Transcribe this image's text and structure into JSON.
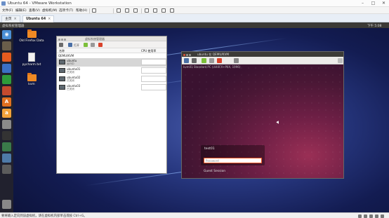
{
  "window": {
    "title": "Ubuntu 64 - VMware Workstation"
  },
  "menu": {
    "items": [
      "文件(F)",
      "编辑(E)",
      "查看(V)",
      "虚拟机(M)",
      "选项卡(T)",
      "帮助(H)"
    ]
  },
  "tabs": [
    {
      "label": "主页",
      "close": "×"
    },
    {
      "label": "Ubuntu 64",
      "close": "×"
    }
  ],
  "guest": {
    "top_left": "虚拟系统管理器",
    "top_right": "下午 5:08"
  },
  "desktop_icons": [
    {
      "label": "Old Firefox Data",
      "kind": "folder"
    },
    {
      "label": "pycharm.txt",
      "kind": "file"
    },
    {
      "label": "kvm",
      "kind": "folder"
    }
  ],
  "virt_manager": {
    "title": "虚拟系统管理器",
    "toolbar_open": "打开",
    "col_name": "名称",
    "col_cpu": "CPU 使用率",
    "group": "QEMU/KVM",
    "vms": [
      {
        "name": "ubuntu",
        "state": "运行中",
        "selected": true
      },
      {
        "name": "ubuntu01",
        "state": "已关闭",
        "selected": false
      },
      {
        "name": "ubuntu02",
        "state": "已关闭",
        "selected": false
      },
      {
        "name": "ubuntu03",
        "state": "已关闭",
        "selected": false
      }
    ]
  },
  "console": {
    "title": "ubuntu 在 QEMU/KVM",
    "screen_header": "kvm01 Standard PC (i440FX+PIIX, 1996)",
    "username": "test01",
    "password_placeholder": "Password",
    "guest_session": "Guest Session"
  },
  "status": {
    "text": "要将输入定向到该虚拟机，请在虚拟机内部单击或按 Ctrl+G。"
  },
  "colors": {
    "desktop_bg": "#131c52",
    "console_bg": "#6d1f45",
    "ubuntu_orange": "#e95420",
    "folder": "#f08a24"
  }
}
